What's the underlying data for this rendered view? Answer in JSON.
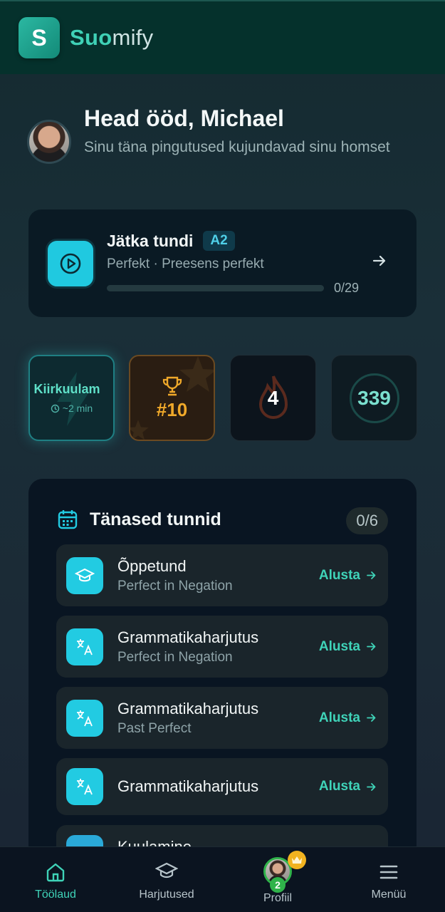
{
  "brand": {
    "prefix": "Suo",
    "suffix": "mify",
    "logo_letter": "S"
  },
  "greeting": {
    "title": "Head ööd, Michael",
    "subtitle": "Sinu täna pingutused kujundavad sinu homset"
  },
  "continue_lesson": {
    "title": "Jätka tundi",
    "level": "A2",
    "subtitle": "Perfekt · Preesens perfekt",
    "progress_text": "0/29",
    "progress_fraction": 0
  },
  "stats": {
    "quick": {
      "label": "Kiirkuulam",
      "time": "~2 min"
    },
    "rank": {
      "value": "#10"
    },
    "streak": {
      "value": "4"
    },
    "xp": {
      "value": "339"
    }
  },
  "lessons": {
    "title": "Tänased tunnid",
    "count": "0/6",
    "items": [
      {
        "title": "Õppetund",
        "subtitle": "Perfect in Negation",
        "action": "Alusta",
        "icon": "graduation-cap-icon"
      },
      {
        "title": "Grammatikaharjutus",
        "subtitle": "Perfect in Negation",
        "action": "Alusta",
        "icon": "translate-icon"
      },
      {
        "title": "Grammatikaharjutus",
        "subtitle": "Past Perfect",
        "action": "Alusta",
        "icon": "translate-icon"
      },
      {
        "title": "Grammatikaharjutus",
        "subtitle": "",
        "action": "Alusta",
        "icon": "translate-icon"
      },
      {
        "title": "Kuulamine",
        "subtitle": "",
        "action": "",
        "icon": "headphones-icon"
      }
    ]
  },
  "nav": {
    "home": "Töölaud",
    "exercises": "Harjutused",
    "profile": "Profiil",
    "profile_level": "2",
    "menu": "Menüü"
  },
  "colors": {
    "accent": "#22cbe2",
    "brand_green": "#3fd1b6",
    "header_bg": "#05312c",
    "gold": "#f0a92a"
  }
}
